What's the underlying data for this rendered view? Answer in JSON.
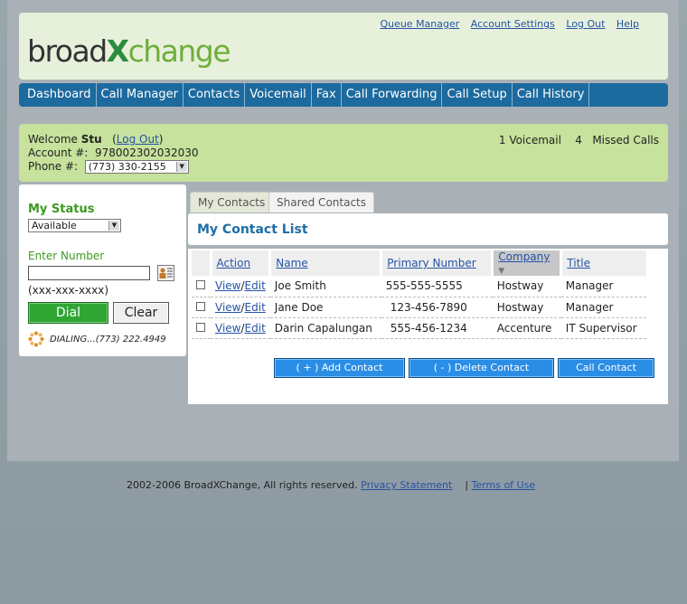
{
  "header": {
    "logo": {
      "part1": "broad",
      "part2": "X",
      "part3": "change"
    },
    "links": [
      "Queue Manager",
      "Account Settings",
      "Log Out",
      "Help"
    ]
  },
  "nav": [
    "Dashboard",
    "Call Manager",
    "Contacts",
    "Voicemail",
    "Fax",
    "Call Forwarding",
    "Call Setup",
    "Call History"
  ],
  "info": {
    "welcome_label": "Welcome",
    "user": "Stu",
    "logout": "Log Out",
    "account_label": "Account #:",
    "account_number": "978002302032030",
    "phone_label": "Phone #:",
    "phone_value": "(773) 330-2155",
    "voicemail_count": "1",
    "voicemail_label": "Voicemail",
    "missed_count": "4",
    "missed_label": "Missed Calls"
  },
  "left_panel": {
    "status_title": "My Status",
    "status_value": "Available",
    "enter_label": "Enter Number",
    "number_value": "",
    "number_format": "(xxx-xxx-xxxx)",
    "dial": "Dial",
    "clear": "Clear",
    "dialing": "DIALING...(773) 222.4949"
  },
  "tabs": [
    "My Contacts",
    "Shared Contacts"
  ],
  "list_title": "My Contact List",
  "columns": [
    "Action",
    "Name",
    "Primary Number",
    "Company",
    "Title"
  ],
  "contacts": [
    {
      "view": "View",
      "edit": "Edit",
      "name": "Joe Smith",
      "number": "555-555-5555",
      "company": "Hostway",
      "title": "Manager"
    },
    {
      "view": "View",
      "edit": "Edit",
      "name": "Jane Doe",
      "number": "123-456-7890",
      "company": "Hostway",
      "title": "Manager"
    },
    {
      "view": "View",
      "edit": "Edit",
      "name": "Darin Capalungan",
      "number": "555-456-1234",
      "company": "Accenture",
      "title": "IT Supervisor"
    }
  ],
  "buttons": {
    "add": "( + ) Add Contact",
    "delete": "( - ) Delete Contact",
    "call": "Call Contact"
  },
  "footer": {
    "copyright": "2002-2006 BroadXChange, All rights reserved.",
    "privacy": "Privacy Statement",
    "sep": "|",
    "terms": "Terms of Use"
  },
  "colors": {
    "nav": "#1c6a9e",
    "info_bar": "#c6e29c",
    "header": "#e6f0db",
    "dial": "#2fa534",
    "action_button": "#2b8ee6"
  }
}
